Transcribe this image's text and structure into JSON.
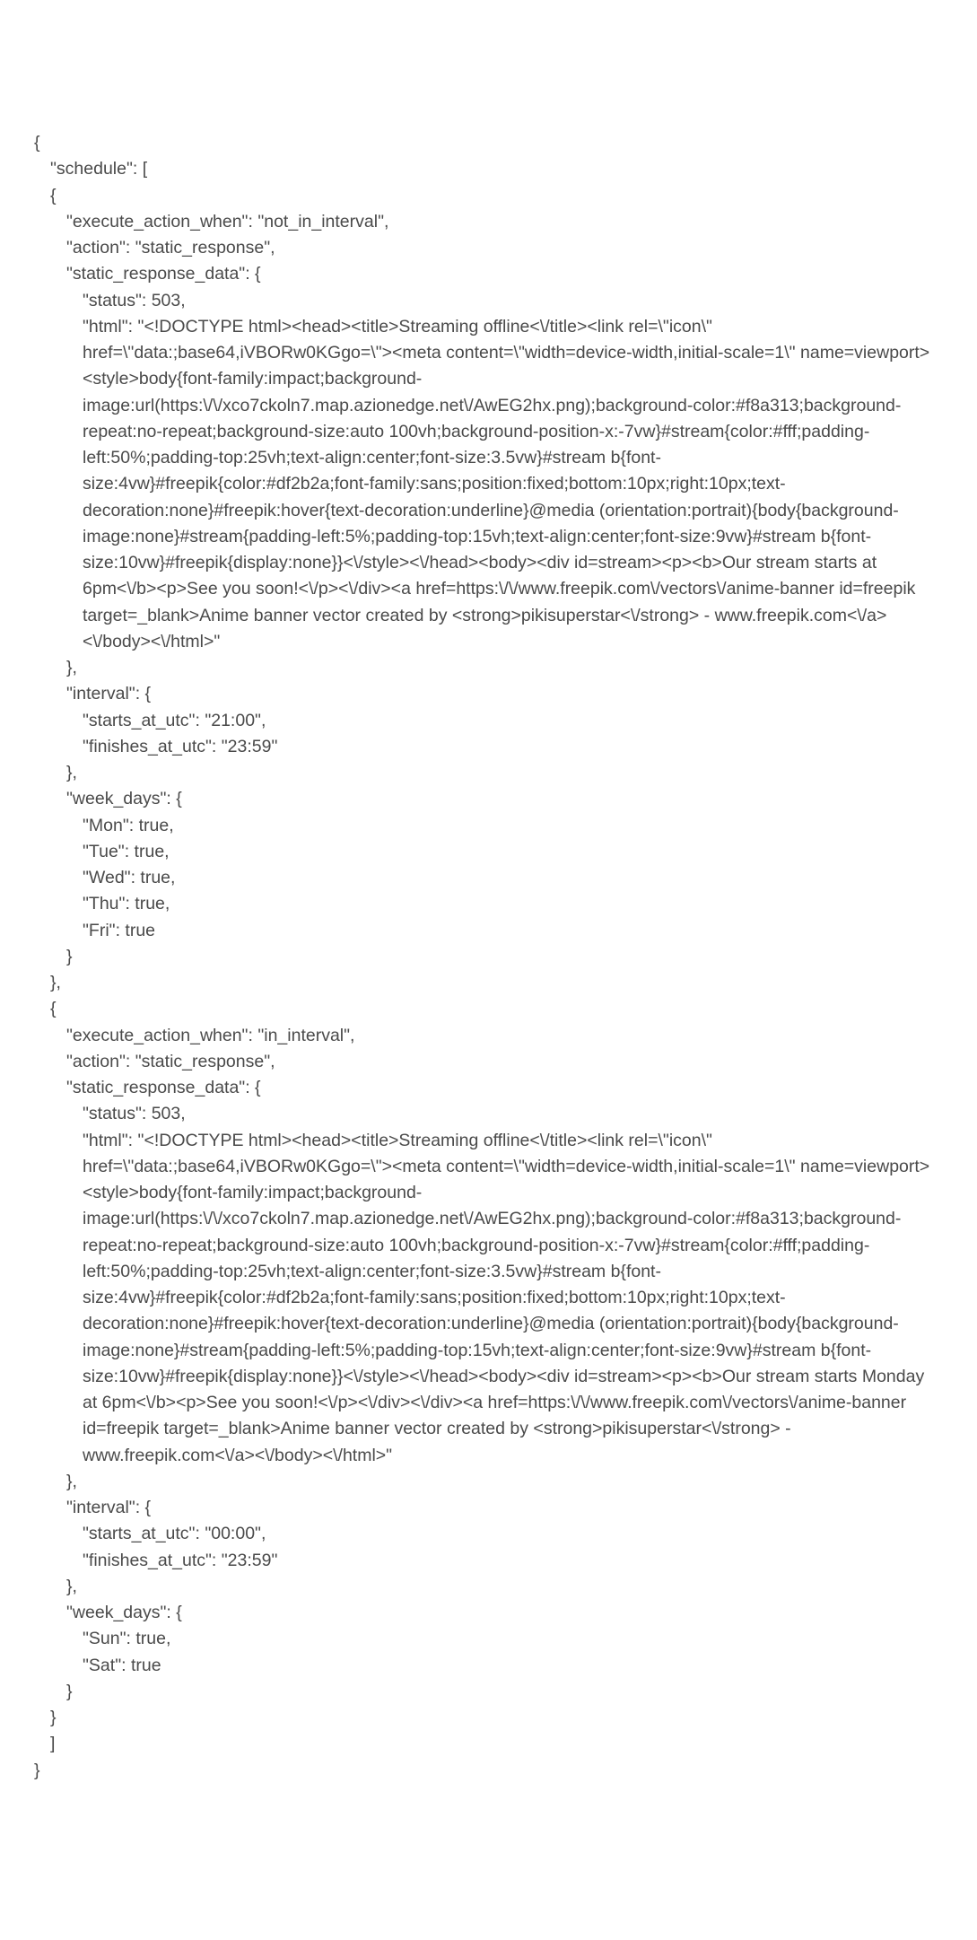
{
  "lines": [
    {
      "lvl": 0,
      "text": "{"
    },
    {
      "lvl": 1,
      "text": "\"schedule\": ["
    },
    {
      "lvl": 1,
      "text": "{"
    },
    {
      "lvl": 2,
      "text": "\"execute_action_when\": \"not_in_interval\","
    },
    {
      "lvl": 2,
      "text": "\"action\": \"static_response\","
    },
    {
      "lvl": 2,
      "text": "\"static_response_data\": {"
    },
    {
      "lvl": 3,
      "text": "\"status\": 503,"
    },
    {
      "lvl": 3,
      "text": "\"html\": \"<!DOCTYPE html><head><title>Streaming offline<\\/title><link rel=\\\"icon\\\" href=\\\"data:;base64,iVBORw0KGgo=\\\"><meta content=\\\"width=device-width,initial-scale=1\\\" name=viewport><style>body{font-family:impact;background-image:url(https:\\/\\/xco7ckoln7.map.azionedge.net\\/AwEG2hx.png);background-color:#f8a313;background-repeat:no-repeat;background-size:auto 100vh;background-position-x:-7vw}#stream{color:#fff;padding-left:50%;padding-top:25vh;text-align:center;font-size:3.5vw}#stream b{font-size:4vw}#freepik{color:#df2b2a;font-family:sans;position:fixed;bottom:10px;right:10px;text-decoration:none}#freepik:hover{text-decoration:underline}@media (orientation:portrait){body{background-image:none}#stream{padding-left:5%;padding-top:15vh;text-align:center;font-size:9vw}#stream b{font-size:10vw}#freepik{display:none}}<\\/style><\\/head><body><div id=stream><p><b>Our stream starts at 6pm<\\/b><p>See you soon!<\\/p><\\/div><a href=https:\\/\\/www.freepik.com\\/vectors\\/anime-banner id=freepik target=_blank>Anime banner vector created by <strong>pikisuperstar<\\/strong> - www.freepik.com<\\/a><\\/body><\\/html>\""
    },
    {
      "lvl": 2,
      "text": "},"
    },
    {
      "lvl": 2,
      "text": "\"interval\": {"
    },
    {
      "lvl": 3,
      "text": "\"starts_at_utc\": \"21:00\","
    },
    {
      "lvl": 3,
      "text": "\"finishes_at_utc\": \"23:59\""
    },
    {
      "lvl": 2,
      "text": "},"
    },
    {
      "lvl": 2,
      "text": "\"week_days\": {"
    },
    {
      "lvl": 3,
      "text": "\"Mon\": true,"
    },
    {
      "lvl": 3,
      "text": "\"Tue\": true,"
    },
    {
      "lvl": 3,
      "text": "\"Wed\": true,"
    },
    {
      "lvl": 3,
      "text": "\"Thu\": true,"
    },
    {
      "lvl": 3,
      "text": "\"Fri\": true"
    },
    {
      "lvl": 2,
      "text": "}"
    },
    {
      "lvl": 1,
      "text": "},"
    },
    {
      "lvl": 1,
      "text": "{"
    },
    {
      "lvl": 2,
      "text": "\"execute_action_when\": \"in_interval\","
    },
    {
      "lvl": 2,
      "text": "\"action\": \"static_response\","
    },
    {
      "lvl": 2,
      "text": "\"static_response_data\": {"
    },
    {
      "lvl": 3,
      "text": "\"status\": 503,"
    },
    {
      "lvl": 3,
      "text": "\"html\": \"<!DOCTYPE html><head><title>Streaming offline<\\/title><link rel=\\\"icon\\\" href=\\\"data:;base64,iVBORw0KGgo=\\\"><meta content=\\\"width=device-width,initial-scale=1\\\" name=viewport><style>body{font-family:impact;background-image:url(https:\\/\\/xco7ckoln7.map.azionedge.net\\/AwEG2hx.png);background-color:#f8a313;background-repeat:no-repeat;background-size:auto 100vh;background-position-x:-7vw}#stream{color:#fff;padding-left:50%;padding-top:25vh;text-align:center;font-size:3.5vw}#stream b{font-size:4vw}#freepik{color:#df2b2a;font-family:sans;position:fixed;bottom:10px;right:10px;text-decoration:none}#freepik:hover{text-decoration:underline}@media (orientation:portrait){body{background-image:none}#stream{padding-left:5%;padding-top:15vh;text-align:center;font-size:9vw}#stream b{font-size:10vw}#freepik{display:none}}<\\/style><\\/head><body><div id=stream><p><b>Our stream starts Monday at 6pm<\\/b><p>See you soon!<\\/p><\\/div><\\/div><a href=https:\\/\\/www.freepik.com\\/vectors\\/anime-banner id=freepik target=_blank>Anime banner vector created by <strong>pikisuperstar<\\/strong> - www.freepik.com<\\/a><\\/body><\\/html>\""
    },
    {
      "lvl": 2,
      "text": "},"
    },
    {
      "lvl": 2,
      "text": "\"interval\": {"
    },
    {
      "lvl": 3,
      "text": "\"starts_at_utc\": \"00:00\","
    },
    {
      "lvl": 3,
      "text": "\"finishes_at_utc\": \"23:59\""
    },
    {
      "lvl": 2,
      "text": "},"
    },
    {
      "lvl": 2,
      "text": "\"week_days\": {"
    },
    {
      "lvl": 3,
      "text": "\"Sun\": true,"
    },
    {
      "lvl": 3,
      "text": "\"Sat\": true"
    },
    {
      "lvl": 2,
      "text": "}"
    },
    {
      "lvl": 1,
      "text": "}"
    },
    {
      "lvl": 1,
      "text": "]"
    },
    {
      "lvl": 0,
      "text": "}"
    }
  ]
}
